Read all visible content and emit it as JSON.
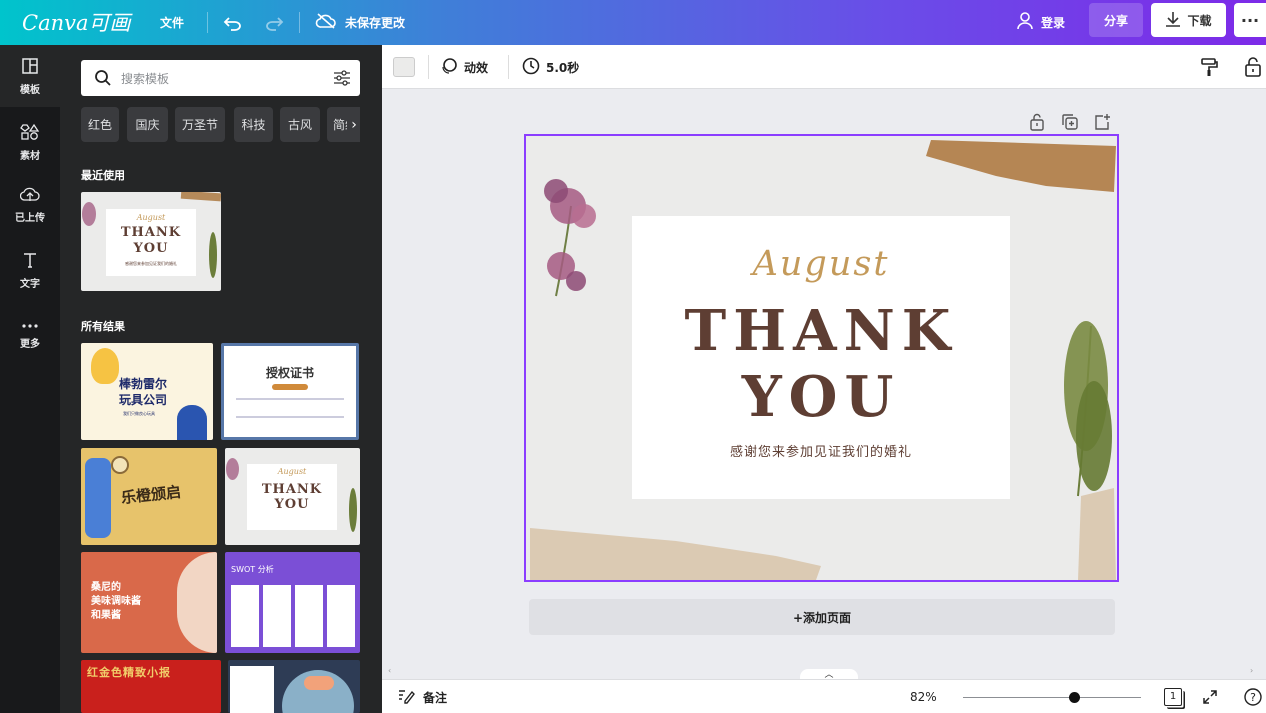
{
  "topbar": {
    "logo": "Canva可画",
    "file_menu": "文件",
    "save_status": "未保存更改",
    "login": "登录",
    "share": "分享",
    "download": "下载",
    "more": "···"
  },
  "rail": {
    "items": [
      {
        "label": "模板",
        "icon": "template-icon"
      },
      {
        "label": "素材",
        "icon": "elements-icon"
      },
      {
        "label": "已上传",
        "icon": "upload-icon"
      },
      {
        "label": "文字",
        "icon": "text-icon"
      },
      {
        "label": "更多",
        "icon": "more-dots-icon"
      }
    ]
  },
  "panel": {
    "search": {
      "placeholder": "搜索模板"
    },
    "chips": [
      "红色",
      "国庆",
      "万圣节",
      "科技",
      "古风",
      "简约"
    ],
    "recent_title": "最近使用",
    "all_results_title": "所有结果",
    "thumbs": {
      "recent": {
        "script": "August",
        "line1": "THANK",
        "line2": "YOU",
        "sub": "感谢您来参加见证我们的婚礼"
      },
      "t1": {
        "line1": "棒勃雷尔",
        "line2": "玩具公司",
        "sub": "我们只做良心玩具"
      },
      "t2": {
        "title": "授权证书"
      },
      "t3": {
        "title": "乐橙颁启"
      },
      "t4": {
        "script": "August",
        "line1": "THANK",
        "line2": "YOU"
      },
      "t5": {
        "line1": "桑尼的",
        "line2": "美味调味酱",
        "line3": "和果酱"
      },
      "t6": {
        "title": "SWOT 分析"
      },
      "t7": {
        "title": "红金色精致小报"
      }
    }
  },
  "context_bar": {
    "animate": "动效",
    "duration": "5.0秒"
  },
  "design": {
    "script": "August",
    "line1": "THANK",
    "line2": "YOU",
    "subtitle": "感谢您来参加见证我们的婚礼"
  },
  "canvas": {
    "add_page": "+添加页面"
  },
  "bottom": {
    "notes": "备注",
    "zoom": "82%",
    "zoom_level": 0.82,
    "page_count": "1"
  },
  "colors": {
    "accent": "#8b3dff",
    "title_brown": "#5e3e33",
    "script_gold": "#c49a5a"
  }
}
